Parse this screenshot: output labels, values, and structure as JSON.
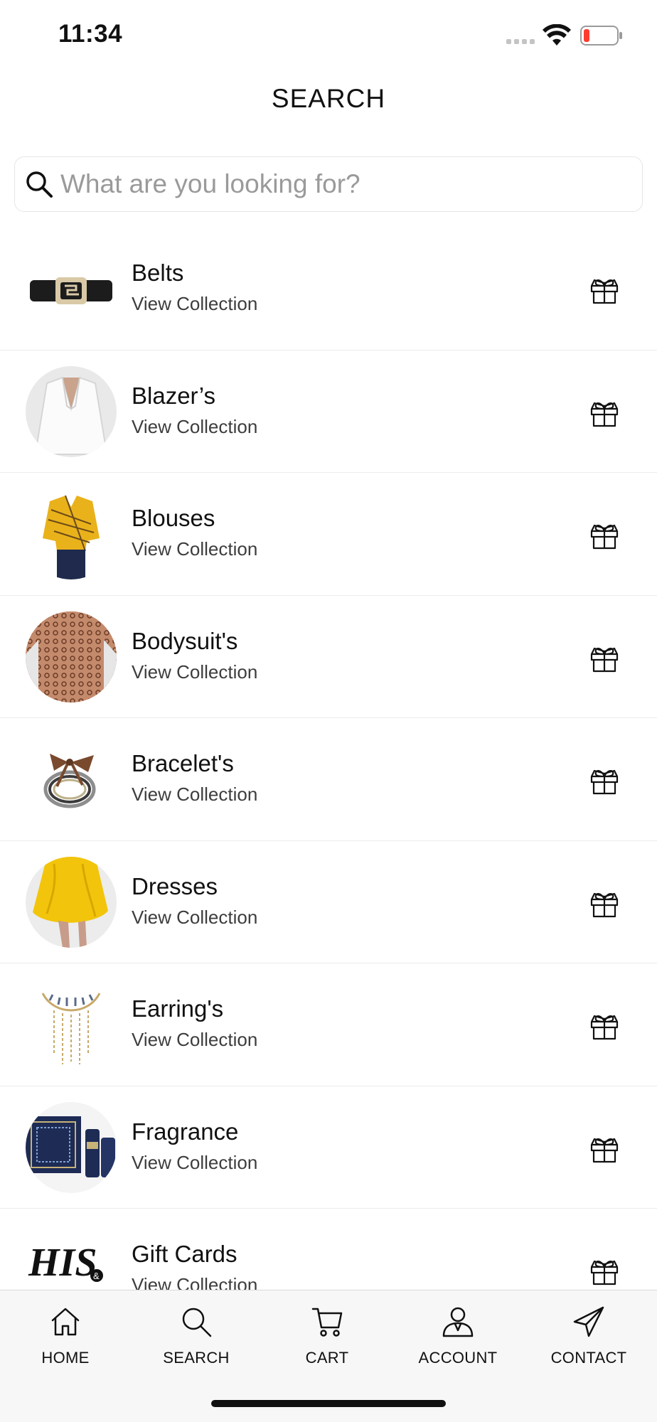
{
  "status_bar": {
    "time": "11:34",
    "battery_color": "#ff3b30"
  },
  "header": {
    "title": "SEARCH"
  },
  "search": {
    "placeholder": "What are you looking for?",
    "value": ""
  },
  "collections": [
    {
      "title": "Belts",
      "subtitle": "View Collection",
      "action_icon": "gift-box-icon"
    },
    {
      "title": "Blazer’s",
      "subtitle": "View Collection",
      "action_icon": "gift-box-icon"
    },
    {
      "title": "Blouses",
      "subtitle": "View Collection",
      "action_icon": "gift-box-icon"
    },
    {
      "title": "Bodysuit's",
      "subtitle": "View Collection",
      "action_icon": "gift-box-icon"
    },
    {
      "title": "Bracelet's",
      "subtitle": "View Collection",
      "action_icon": "gift-box-icon"
    },
    {
      "title": "Dresses",
      "subtitle": "View Collection",
      "action_icon": "gift-box-icon"
    },
    {
      "title": "Earring's",
      "subtitle": "View Collection",
      "action_icon": "gift-box-icon"
    },
    {
      "title": "Fragrance",
      "subtitle": "View Collection",
      "action_icon": "gift-box-icon"
    },
    {
      "title": "Gift Cards",
      "subtitle": "View Collection",
      "action_icon": "gift-box-icon"
    }
  ],
  "gift_card_logo": {
    "text": "HIS & HERS"
  },
  "nav": {
    "items": [
      {
        "label": "HOME",
        "icon": "home-icon"
      },
      {
        "label": "SEARCH",
        "icon": "search-icon"
      },
      {
        "label": "CART",
        "icon": "cart-icon"
      },
      {
        "label": "ACCOUNT",
        "icon": "account-icon"
      },
      {
        "label": "CONTACT",
        "icon": "send-icon"
      }
    ]
  }
}
